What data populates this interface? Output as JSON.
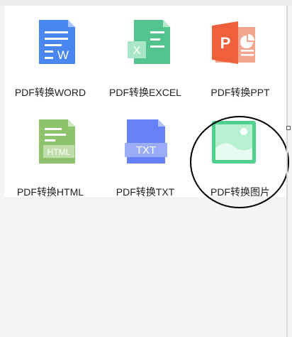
{
  "tools": [
    {
      "label": "PDF转换WORD",
      "badge": "W",
      "icon": "pdf-to-word-icon",
      "color": "#4a86f0"
    },
    {
      "label": "PDF转换EXCEL",
      "badge": "X",
      "icon": "pdf-to-excel-icon",
      "color": "#53c48e"
    },
    {
      "label": "PDF转换PPT",
      "badge": "P",
      "icon": "pdf-to-ppt-icon",
      "color": "#ee5f3c"
    },
    {
      "label": "PDF转换HTML",
      "badge": "HTML",
      "icon": "pdf-to-html-icon",
      "color": "#8ec36d"
    },
    {
      "label": "PDF转换TXT",
      "badge": "TXT",
      "icon": "pdf-to-txt-icon",
      "color": "#6680f5"
    },
    {
      "label": "PDF转换图片",
      "icon": "pdf-to-image-icon",
      "color": "#4fd08c"
    }
  ]
}
